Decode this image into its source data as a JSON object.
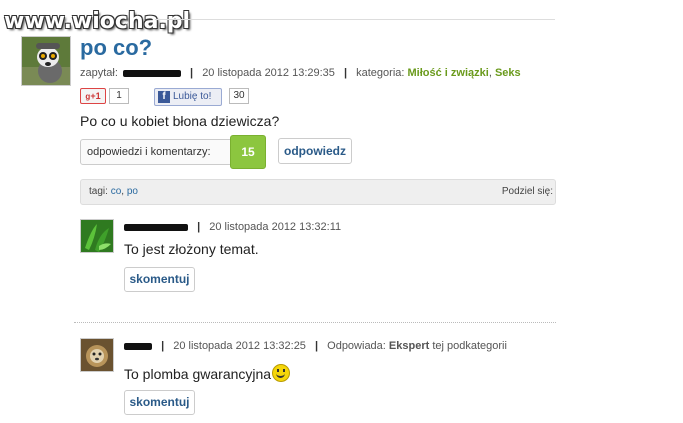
{
  "watermark": "www.wiocha.pl",
  "question": {
    "title": "po co?",
    "asked_label": "zapytał:",
    "date": "20 listopada 2012 13:29:35",
    "category_label": "kategoria:",
    "category_1": "Miłość i związki",
    "category_sep": ", ",
    "category_2": "Seks",
    "gplus_label": "+1",
    "gplus_count": "1",
    "fb_label": "Lubię to!",
    "fb_count": "30",
    "body": "Po co u kobiet błona dziewicza?",
    "answers_label": "odpowiedzi i komentarzy:",
    "answers_count": "15",
    "reply_button": "odpowiedz",
    "tags_label": "tagi:",
    "tags": [
      "co",
      "po"
    ],
    "tags_sep": ", ",
    "share_label": "Podziel się:"
  },
  "answers": [
    {
      "date": "20 listopada 2012 13:32:11",
      "text": "To jest złożony temat.",
      "comment_button": "skomentuj"
    },
    {
      "date": "20 listopada 2012 13:32:25",
      "answered_label": "Odpowiada:",
      "rank": "Ekspert",
      "rank_suffix": "tej podkategorii",
      "text": "To plomba gwarancyjna",
      "comment_button": "skomentuj"
    }
  ],
  "colors": {
    "link": "#2a6aa0",
    "category": "#6a9a1c",
    "count_badge": "#8cc63f"
  }
}
